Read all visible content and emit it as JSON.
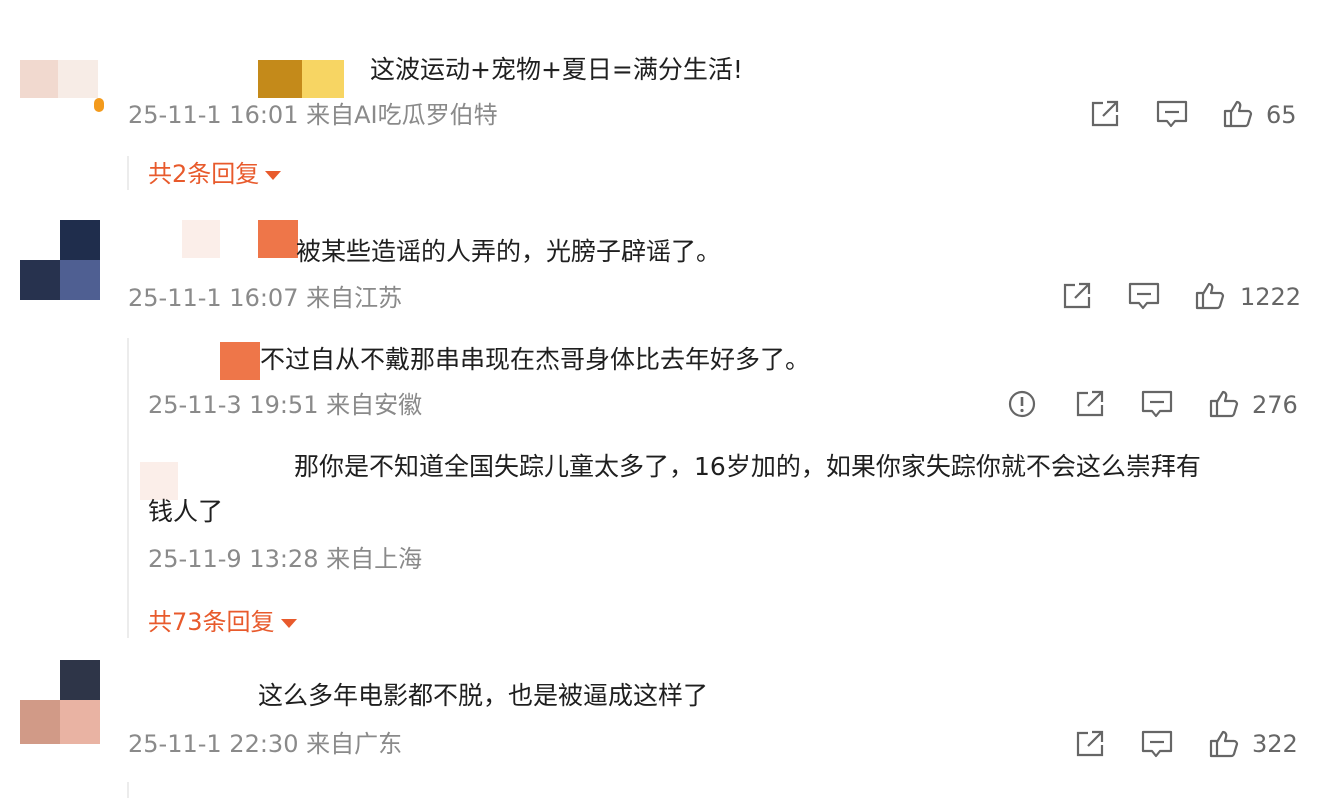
{
  "comments": [
    {
      "text": "这波运动+宠物+夏日=满分生活!",
      "meta": "25-11-1 16:01 来自AI吃瓜罗伯特",
      "likes": "65",
      "replies_label": "共2条回复"
    },
    {
      "text": "被某些造谣的人弄的，光膀子辟谣了。",
      "meta": "25-11-1 16:07 来自江苏",
      "likes": "1222",
      "replies": [
        {
          "text": "不过自从不戴那串串现在杰哥身体比去年好多了。",
          "meta": "25-11-3 19:51 来自安徽",
          "likes": "276"
        },
        {
          "text_line1": "那你是不知道全国失踪儿童太多了，16岁加的，如果你家失踪你就不会这么崇拜有",
          "text_line2": "钱人了",
          "meta": "25-11-9 13:28 来自上海"
        }
      ],
      "replies_label": "共73条回复"
    },
    {
      "text": "这么多年电影都不脱，也是被逼成这样了",
      "meta": "25-11-1 22:30 来自广东",
      "likes": "322"
    }
  ],
  "icons": {
    "share": "share-icon",
    "comment": "comment-icon",
    "like": "thumbs-up-icon",
    "report": "report-icon"
  },
  "colors": {
    "accent": "#e85a2c",
    "meta_text": "#8a8a8a"
  }
}
